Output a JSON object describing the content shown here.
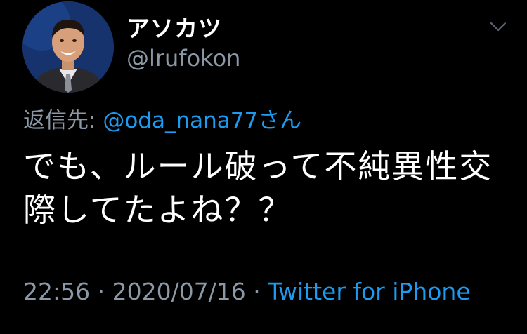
{
  "author": {
    "display_name": "アソカツ",
    "handle": "@lrufokon"
  },
  "reply": {
    "prefix": "返信先: ",
    "mention": "@oda_nana77さん"
  },
  "tweet": {
    "line1": "でも、ルール破って不純異性交",
    "line2": "際してたよね？？"
  },
  "meta": {
    "time": "22:56",
    "separator": " · ",
    "date": "2020/07/16",
    "source": "Twitter for iPhone"
  },
  "icons": {
    "menu": "chevron-down-icon"
  },
  "colors": {
    "background": "#000000",
    "text": "#ffffff",
    "secondary": "#8b98a5",
    "link": "#1d9bf0"
  }
}
